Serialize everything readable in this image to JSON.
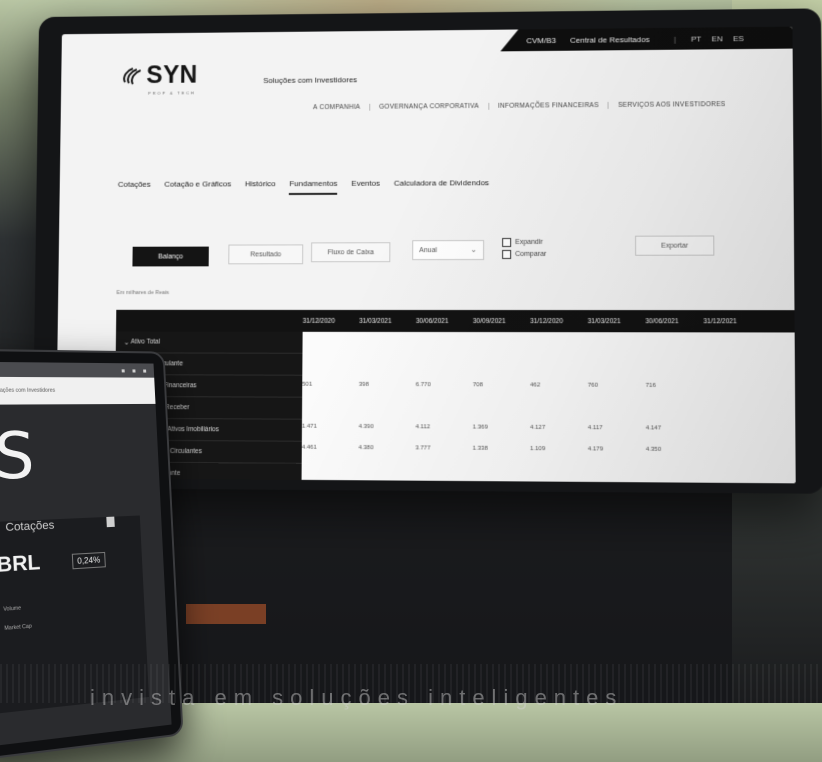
{
  "colors": {
    "dark": "#141414",
    "screen_bg": "#f3f3f3",
    "text": "#222222"
  },
  "brand": {
    "name": "SYN",
    "tagline": "PROP & TECH",
    "site_subtitle": "Soluções com Investidores"
  },
  "topbar": {
    "items": [
      "CVM/B3",
      "Central de Resultados"
    ],
    "langs": [
      "PT",
      "EN",
      "ES"
    ]
  },
  "mainnav": [
    "A COMPANHIA",
    "GOVERNANÇA CORPORATIVA",
    "INFORMAÇÕES FINANCEIRAS",
    "SERVIÇOS AOS INVESTIDORES"
  ],
  "tabs": [
    "Cotações",
    "Cotação e Gráficos",
    "Histórico",
    "Fundamentos",
    "Eventos",
    "Calculadora de Dividendos"
  ],
  "controls": {
    "btn_primary": "Balanço",
    "btn_2": "Resultado",
    "btn_3": "Fluxo de Caixa",
    "select_value": "Anual",
    "check_1": "Expandir",
    "check_2": "Comparar",
    "export": "Exportar"
  },
  "note": "Em milhares de Reais",
  "table": {
    "columns": [
      "31/12/2020",
      "31/03/2021",
      "30/06/2021",
      "30/09/2021",
      "31/12/2020",
      "31/03/2021",
      "30/06/2021",
      "31/12/2021"
    ],
    "row_labels": [
      "Ativo Total",
      "Ativo Circulante",
      "Aplicações Financeiras",
      "Contas a Receber",
      "Estoques de Ativos Imobiliários",
      "Outros Ativos Circulantes",
      "Ativo Não Circulante"
    ],
    "rows": [
      [
        "",
        "",
        "",
        "",
        "",
        "",
        "",
        ""
      ],
      [
        "",
        "",
        "",
        "",
        "",
        "",
        "",
        ""
      ],
      [
        "501",
        "398",
        "6.770",
        "708",
        "462",
        "760",
        "716",
        ""
      ],
      [
        "",
        "",
        "",
        "",
        "",
        "",
        "",
        ""
      ],
      [
        "1.471",
        "4.390",
        "4.112",
        "1.369",
        "4.127",
        "4.117",
        "4.147",
        ""
      ],
      [
        "4.461",
        "4.380",
        "3.777",
        "1.338",
        "1.109",
        "4.179",
        "4.350",
        ""
      ],
      [
        "",
        "",
        "",
        "",
        "",
        "",
        "",
        ""
      ]
    ]
  },
  "tablet": {
    "nav_text": "Relações com Investidores",
    "card_title": "Cotações",
    "price": "BRL",
    "change": "0,24%",
    "small_1": "Volume",
    "small_2": "Market Cap"
  },
  "overlay": {
    "big_letter": "S",
    "caption": "invista em soluções inteligentes"
  }
}
